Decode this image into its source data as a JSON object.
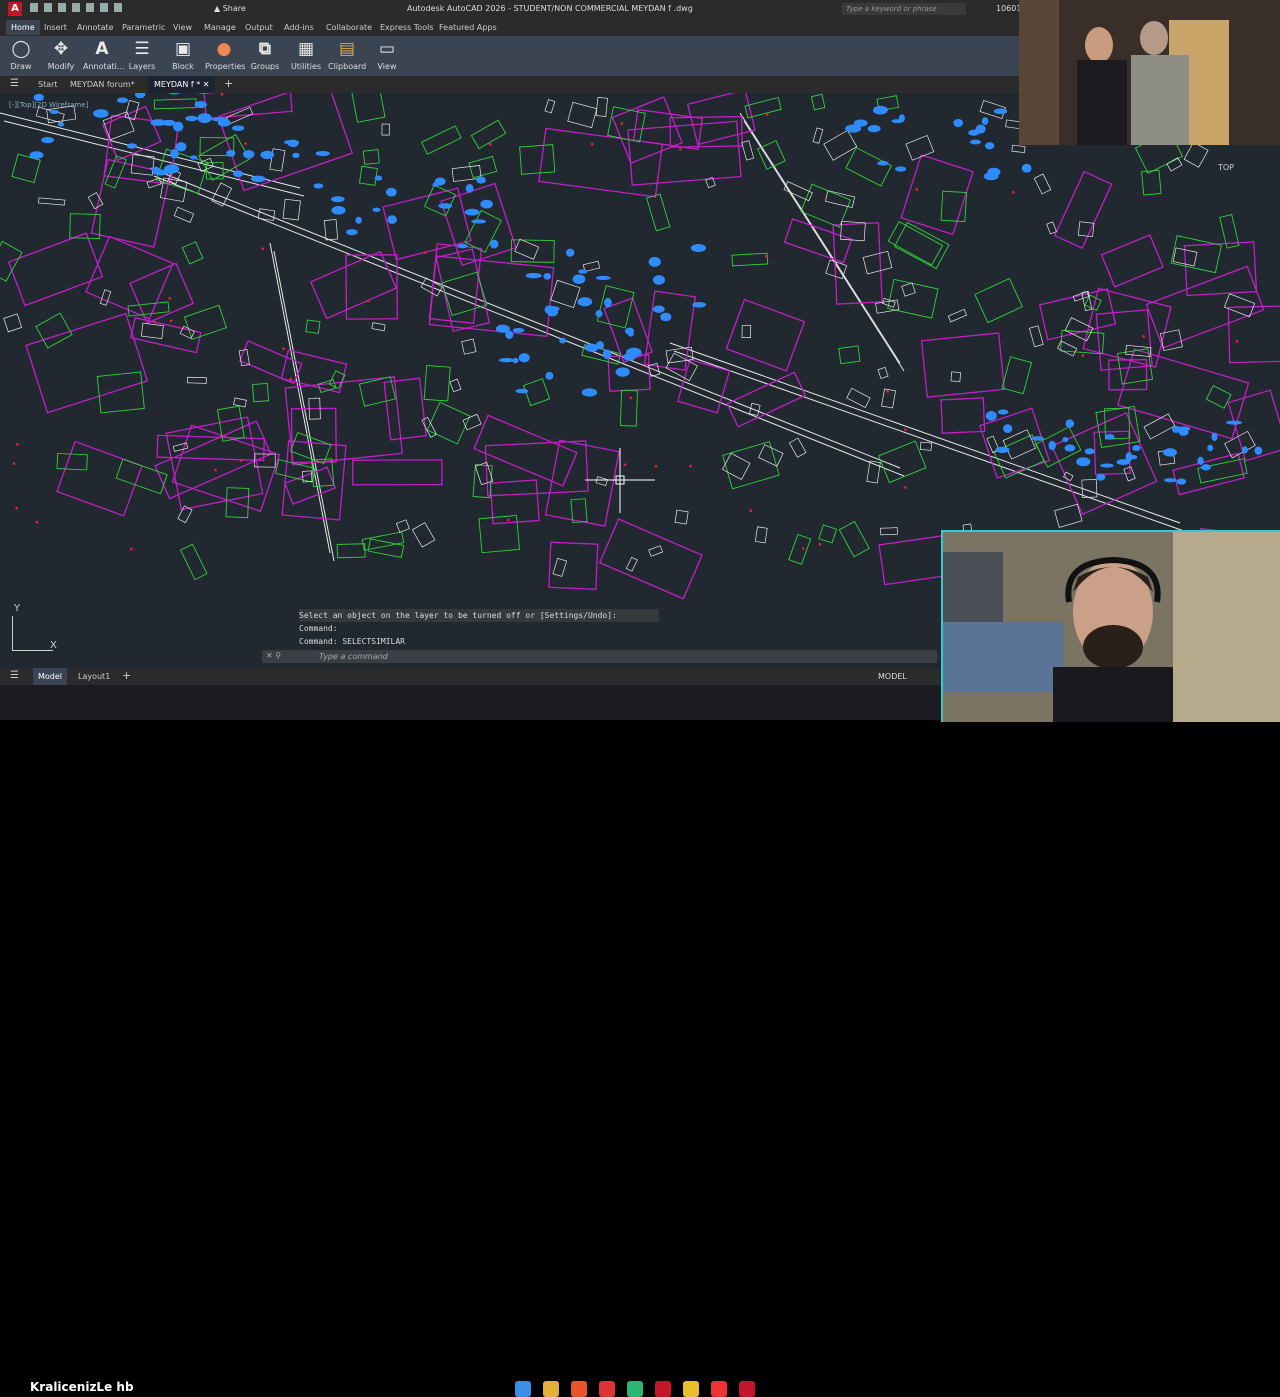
{
  "app": {
    "logo": "A",
    "share_label": "Share",
    "title": "Autodesk AutoCAD 2026 - STUDENT/NON COMMERCIAL    MEYDAN f .dwg",
    "search_placeholder": "Type a keyword or phrase",
    "user_number": "106011"
  },
  "ribbon_tabs": [
    "Home",
    "Insert",
    "Annotate",
    "Parametric",
    "View",
    "Manage",
    "Output",
    "Add-ins",
    "Collaborate",
    "Express Tools",
    "Featured Apps"
  ],
  "ribbon_buttons": [
    {
      "label": "Draw",
      "icon": "draw-icon"
    },
    {
      "label": "Modify",
      "icon": "modify-icon"
    },
    {
      "label": "Annotati...",
      "icon": "annotation-icon"
    },
    {
      "label": "Layers",
      "icon": "layers-icon"
    },
    {
      "label": "Block",
      "icon": "block-icon"
    },
    {
      "label": "Properties",
      "icon": "properties-icon"
    },
    {
      "label": "Groups",
      "icon": "groups-icon"
    },
    {
      "label": "Utilities",
      "icon": "utilities-icon"
    },
    {
      "label": "Clipboard",
      "icon": "clipboard-icon"
    },
    {
      "label": "View",
      "icon": "view-icon"
    }
  ],
  "file_tabs": {
    "start": "Start",
    "tab1": "MEYDAN forum*",
    "tab2": "MEYDAN f *"
  },
  "viewport_label": "[-][Top][2D Wireframe]",
  "ucs": {
    "x": "X",
    "y": "Y"
  },
  "command_history": [
    "Select an object on the layer to be turned off or [Settings/Undo]:",
    "Command:",
    "Command: SELECTSIMILAR"
  ],
  "command_placeholder": "Type a command",
  "layout_tabs": [
    "Model",
    "Layout1"
  ],
  "status": {
    "model": "MODEL"
  },
  "overlay_text": "KralicenizLe  hb",
  "viewcube_label": "TOP",
  "colors": {
    "canvas": "#212830",
    "ribbon": "#3b4453",
    "magenta": "#c21fc6",
    "green": "#2fd33a",
    "blue": "#2f8cff",
    "white": "#e8e8e8"
  }
}
